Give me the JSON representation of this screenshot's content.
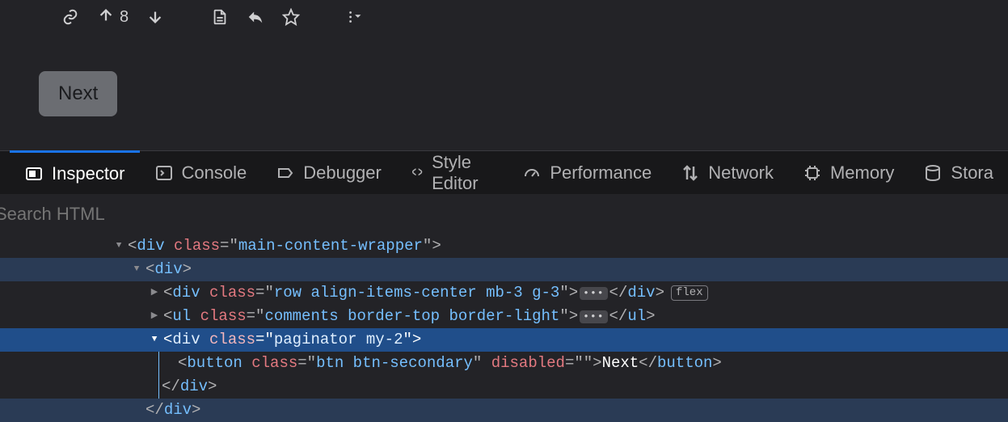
{
  "toolbar": {
    "vote_count": "8"
  },
  "page": {
    "next_button_label": "Next"
  },
  "devtools": {
    "tabs": {
      "inspector": "Inspector",
      "console": "Console",
      "debugger": "Debugger",
      "style_editor": "Style Editor",
      "performance": "Performance",
      "network": "Network",
      "memory": "Memory",
      "storage": "Stora"
    },
    "search_placeholder": "Search HTML"
  },
  "dom": {
    "line1": {
      "tag": "div",
      "attr": "class",
      "val": "main-content-wrapper"
    },
    "line2": {
      "tag": "div"
    },
    "line3": {
      "tag": "div",
      "attr": "class",
      "val": "row align-items-center mb-3 g-3",
      "close": "div",
      "badge": "flex"
    },
    "line4": {
      "tag": "ul",
      "attr": "class",
      "val": "comments border-top border-light",
      "close": "ul"
    },
    "line5": {
      "tag": "div",
      "attr": "class",
      "val": "paginator my-2"
    },
    "line6": {
      "tag": "button",
      "attr1": "class",
      "val1": "btn btn-secondary",
      "attr2": "disabled",
      "val2": "",
      "text": "Next",
      "close": "button"
    },
    "line7": {
      "close": "div"
    },
    "line8": {
      "close": "div"
    }
  }
}
